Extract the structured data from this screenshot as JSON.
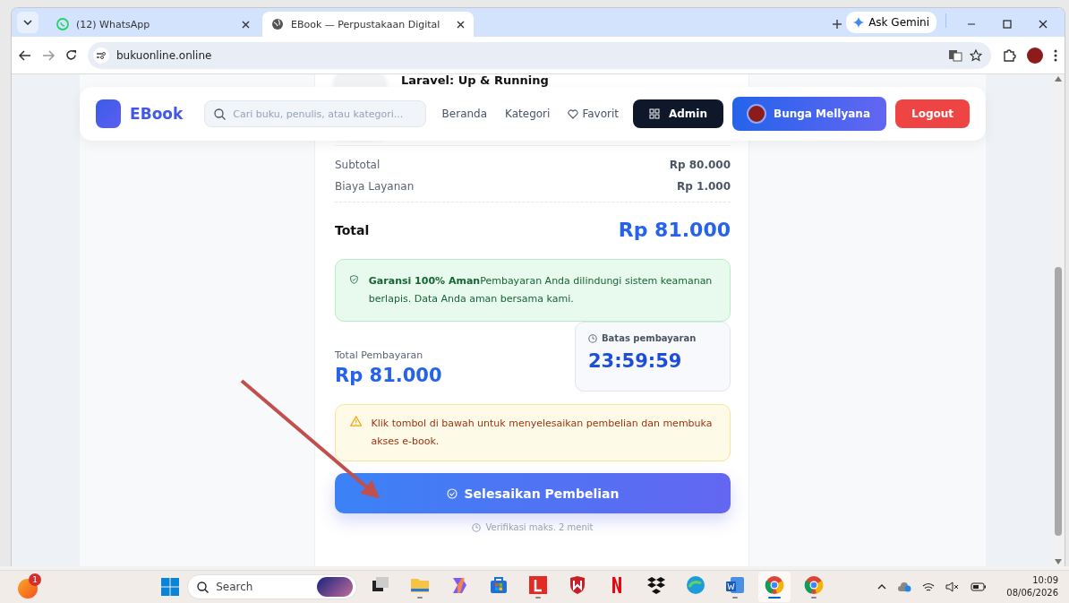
{
  "browser": {
    "tabs": [
      {
        "title": "(12) WhatsApp",
        "kind": "messaging",
        "selected": false
      },
      {
        "title": "EBook — Perpustakaan Digital",
        "kind": "web",
        "selected": true
      }
    ],
    "gemini": "Ask Gemini",
    "url": "bukuonline.online"
  },
  "header": {
    "logo": "EBook",
    "search_placeholder": "Cari buku, penulis, atau kategori...",
    "nav": [
      {
        "label": "Beranda",
        "kind": "link"
      },
      {
        "label": "Kategori",
        "kind": "link"
      },
      {
        "label": "Favorit",
        "kind": "favorites"
      }
    ],
    "admin": "Admin",
    "user": "Bunga Mellyana",
    "logout": "Logout"
  },
  "book": {
    "title": "Laravel: Up & Running"
  },
  "summary": {
    "rows": [
      {
        "label": "Subtotal",
        "value": "Rp 80.000"
      },
      {
        "label": "Biaya Layanan",
        "value": "Rp 1.000"
      }
    ],
    "total_label": "Total",
    "total_value": "Rp 81.000"
  },
  "guarantee": "**Garansi 100% Aman**Pembayaran Anda dilindungi sistem keamanan berlapis. Data Anda aman bersama kami.",
  "payment": {
    "label": "Total Pembayaran",
    "amount": "Rp 81.000",
    "deadline_label": "Batas pembayaran",
    "countdown": "23:59:59"
  },
  "notice": "Klik tombol di bawah untuk menyelesaikan pembelian dan membuka akses e-book.",
  "submit": "Selesaikan Pembelian",
  "verification": "Verifikasi maks. 2 menit",
  "taskbar": {
    "notification_count": "1",
    "search": "Search",
    "apps": [
      {
        "kind": "taskview",
        "open": false,
        "selected": false
      },
      {
        "kind": "folder",
        "open": true,
        "selected": false
      },
      {
        "kind": "copilot",
        "open": false,
        "selected": false
      },
      {
        "kind": "store",
        "open": false,
        "selected": false
      },
      {
        "kind": "letter",
        "open": true,
        "selected": false
      },
      {
        "kind": "shield",
        "open": false,
        "selected": false
      },
      {
        "kind": "netflix",
        "open": false,
        "selected": false
      },
      {
        "kind": "dropbox",
        "open": false,
        "selected": false
      },
      {
        "kind": "edge",
        "open": false,
        "selected": false
      },
      {
        "kind": "word",
        "open": true,
        "selected": false
      },
      {
        "kind": "chrome",
        "open": true,
        "selected": true
      },
      {
        "kind": "chrome",
        "open": true,
        "selected": false
      }
    ],
    "time": "10:09",
    "date": "08/06/2026"
  }
}
